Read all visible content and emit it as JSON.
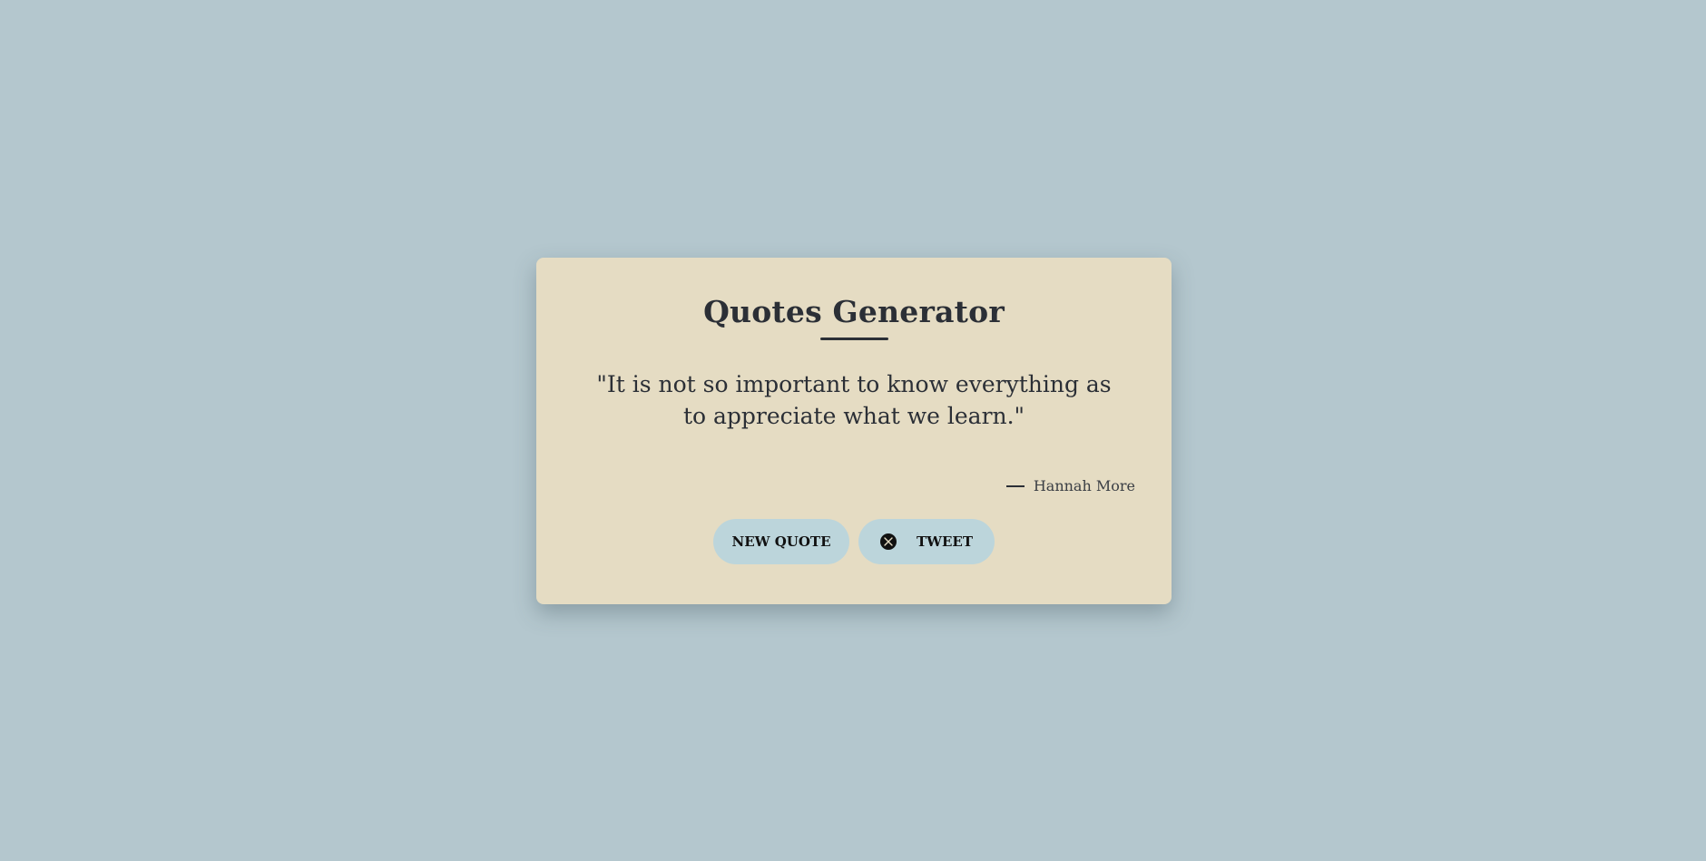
{
  "card": {
    "title": "Quotes Generator",
    "quote": "\"It is not so important to know everything as to appreciate what we learn.\"",
    "author": "Hannah More"
  },
  "buttons": {
    "new_quote_label": "NEW QUOTE",
    "tweet_label": "TWEET"
  },
  "icons": {
    "tweet": "x-logo-icon"
  },
  "colors": {
    "background": "#b4c7ce",
    "card": "#e5dcc3",
    "button": "#bcd5db",
    "text": "#2b2f36"
  }
}
